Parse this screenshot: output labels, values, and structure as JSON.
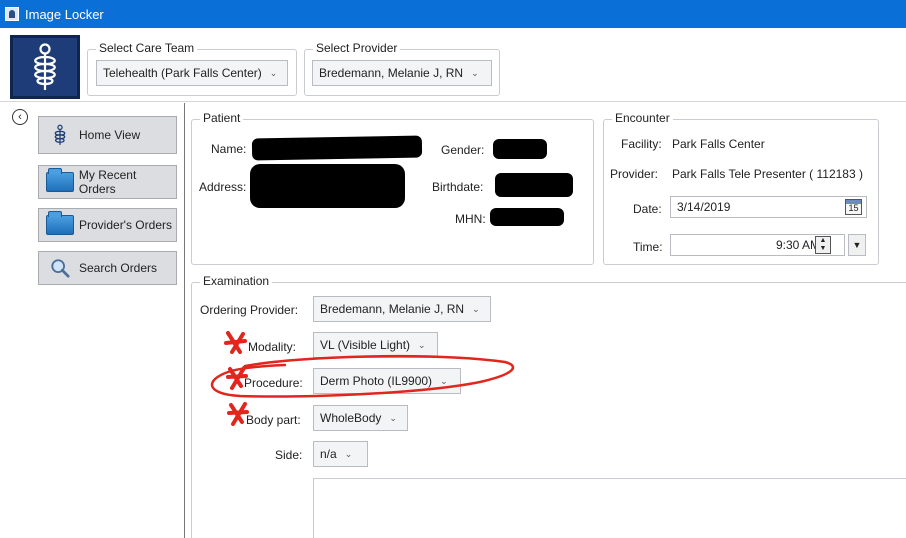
{
  "window": {
    "title": "Image Locker"
  },
  "care_team": {
    "legend": "Select Care Team",
    "value": "Telehealth (Park Falls Center)"
  },
  "provider_select": {
    "legend": "Select Provider",
    "value": "Bredemann, Melanie J, RN"
  },
  "nav": {
    "home": "Home View",
    "recent": "My Recent Orders",
    "providers": "Provider's Orders",
    "search": "Search Orders"
  },
  "patient": {
    "legend": "Patient",
    "name_label": "Name:",
    "address_label": "Address:",
    "gender_label": "Gender:",
    "birthdate_label": "Birthdate:",
    "mhn_label": "MHN:"
  },
  "encounter": {
    "legend": "Encounter",
    "facility_label": "Facility:",
    "facility_value": "Park Falls Center",
    "provider_label": "Provider:",
    "provider_value": "Park Falls Tele Presenter  ( 112183 )",
    "date_label": "Date:",
    "date_value": "3/14/2019",
    "calendar_day": "15",
    "time_label": "Time:",
    "time_value": "9:30 AM"
  },
  "examination": {
    "legend": "Examination",
    "ordering_provider_label": "Ordering Provider:",
    "ordering_provider_value": "Bredemann, Melanie J, RN",
    "modality_label": "Modality:",
    "modality_value": "VL (Visible Light)",
    "procedure_label": "Procedure:",
    "procedure_value": "Derm Photo (IL9900)",
    "body_part_label": "Body part:",
    "body_part_value": "WholeBody",
    "side_label": "Side:",
    "side_value": "n/a"
  },
  "colors": {
    "titlebar": "#0a6fd6",
    "annotation": "#e0261d",
    "logo_bg": "#1d3c78"
  }
}
